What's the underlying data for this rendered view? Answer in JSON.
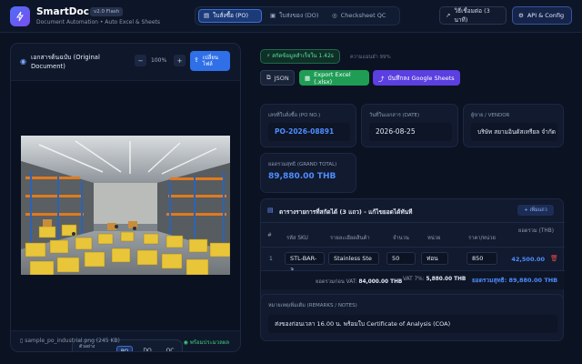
{
  "app": {
    "title": "SmartDoc AI",
    "version": "v2.0 Flash",
    "subtitle": "Document Automation • Auto Excel & Sheets"
  },
  "tabs": [
    {
      "label": "ใบสั่งซื้อ (PO)",
      "icon": "file-icon",
      "active": true
    },
    {
      "label": "ใบส่งของ (DO)",
      "icon": "box-icon",
      "active": false
    },
    {
      "label": "Checksheet QC",
      "icon": "check-circle-icon",
      "active": false
    }
  ],
  "header_buttons": {
    "help": "วิธีเชื่อมต่อ (3 นาที)",
    "api": "API & Config"
  },
  "left": {
    "doc_title": "เอกสารต้นฉบับ (Original Document)",
    "zoom": "100%",
    "change_file": "เปลี่ยน ไฟล์",
    "sample_label": "ตัวอย่าง ทดสอบ:",
    "sample_options": [
      "PO",
      "DO",
      "QC"
    ],
    "selected_sample": "PO",
    "file_name": "sample_po_industrial.png (245 KB)",
    "ready": "พร้อมประมวลผล"
  },
  "right": {
    "speed_badge": "⚡ สกัดข้อมูลสำเร็จใน 1.42s",
    "accuracy": "ความแม่นยำ 99%",
    "json_btn": "JSON",
    "export_btn": "Export Excel (.xlsx)",
    "sheets_btn": "บันทึกลง Google Sheets",
    "po_label": "เลขที่ใบสั่งซื้อ (PO NO.)",
    "po_value": "PO-2026-08891",
    "date_label": "วันที่ในเอกสาร (DATE)",
    "date_value": "2026-08-25",
    "vendor_label": "ผู้ขาย / VENDOR",
    "vendor_value": "บริษัท สยามอินดัสเทรียล จำกัด",
    "total_label": "ยอดรวมสุทธิ (GRAND TOTAL)",
    "total_value": "89,880.00 THB",
    "items_title": "ตารางรายการที่สกัดได้ (3 แถว) - แก้ไขยอดได้ทันที",
    "add_row": "+ เพิ่มแถว",
    "columns": [
      "#",
      "รหัส SKU",
      "รายละเอียดสินค้า",
      "จำนวน",
      "หน่วย",
      "ราคา/หน่วย",
      "ยอดรวม (THB)"
    ],
    "rows": [
      {
        "no": "1",
        "sku": "STL-BAR-3",
        "desc": "Stainless Ste",
        "qty": "50",
        "unit": "ท่อน",
        "price": "850",
        "total": "42,500.00"
      }
    ],
    "subtotal_label": "ยอดรวมก่อน VAT:",
    "subtotal_value": "84,000.00 THB",
    "vat_label": "VAT 7%:",
    "vat_value": "5,880.00 THB",
    "net_label": "ยอดรวมสุทธิ:",
    "net_value": "89,880.00 THB",
    "remarks_label": "หมายเหตุเพิ่มเติม (REMARKS / NOTES)",
    "remarks_value": "ส่งของก่อนเวลา 16.00 น. พร้อมใบ Certificate of Analysis (COA)"
  },
  "colors": {
    "accent": "#2f6fe8",
    "success": "#3ecf7e",
    "excel": "#1f9d55",
    "sheets": "#5b3fe0",
    "po_value": "#4f8dff",
    "delete": "#e04a4a"
  }
}
